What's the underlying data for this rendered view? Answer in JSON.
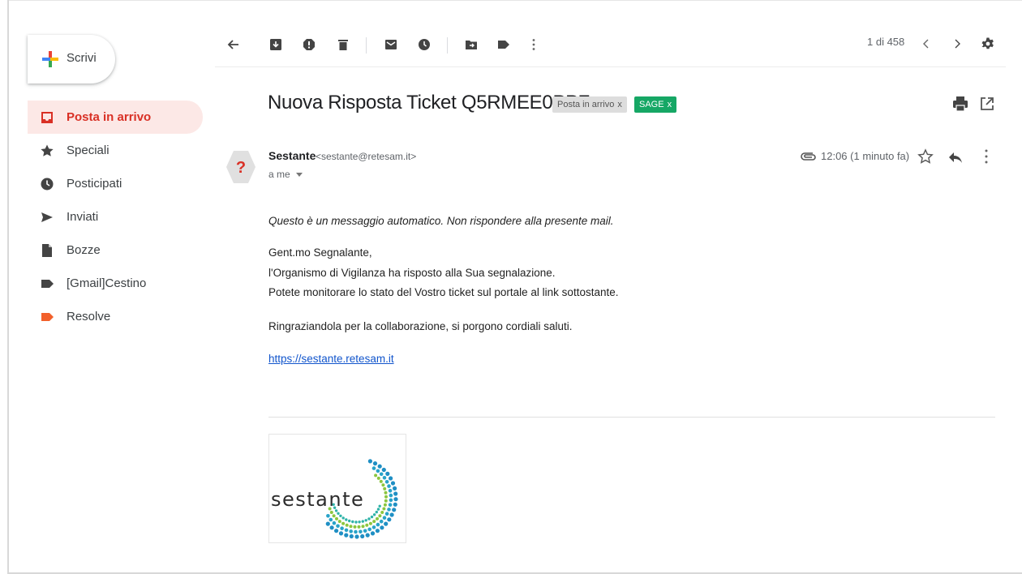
{
  "compose": {
    "label": "Scrivi"
  },
  "sidebar": {
    "items": [
      {
        "label": "Posta in arrivo",
        "icon": "inbox-icon"
      },
      {
        "label": "Speciali",
        "icon": "star-icon"
      },
      {
        "label": "Posticipati",
        "icon": "clock-icon"
      },
      {
        "label": "Inviati",
        "icon": "send-icon"
      },
      {
        "label": "Bozze",
        "icon": "draft-icon"
      },
      {
        "label": "[Gmail]Cestino",
        "icon": "label-icon"
      },
      {
        "label": "Resolve",
        "icon": "label-icon"
      }
    ]
  },
  "toolbar": {
    "icons": [
      "back-arrow-icon",
      "archive-icon",
      "report-spam-icon",
      "delete-icon",
      "mark-unread-icon",
      "snooze-icon",
      "move-to-icon",
      "labels-icon",
      "more-vert-icon"
    ],
    "pager": "1 di 458"
  },
  "message": {
    "subject": "Nuova Risposta Ticket Q5RMEE0PPZ",
    "labels": [
      {
        "text": "Posta in arrivo",
        "remove": "x"
      },
      {
        "text": "SAGE",
        "remove": "x"
      }
    ],
    "sender_name": "Sestante",
    "sender_email": "<sestante@retesam.it>",
    "to": "a me",
    "time": "12:06 (1 minuto fa)",
    "body": {
      "auto_notice": "Questo è un messaggio automatico. Non rispondere alla presente mail.",
      "greeting": "Gent.mo Segnalante,",
      "line1": "l'Organismo di Vigilanza ha risposto alla Sua segnalazione.",
      "line2": "Potete monitorare lo stato del Vostro ticket sul portale al link sottostante.",
      "closing": "Ringraziandola per la collaborazione, si porgono cordiali saluti.",
      "link": "https://sestante.retesam.it"
    },
    "signature_logo_text": "sestante"
  },
  "colors": {
    "accent_red": "#d93025",
    "active_bg": "#fce8e6",
    "sage_label": "#16a765",
    "link": "#1155cc",
    "resolve_label": "#f2602b"
  }
}
